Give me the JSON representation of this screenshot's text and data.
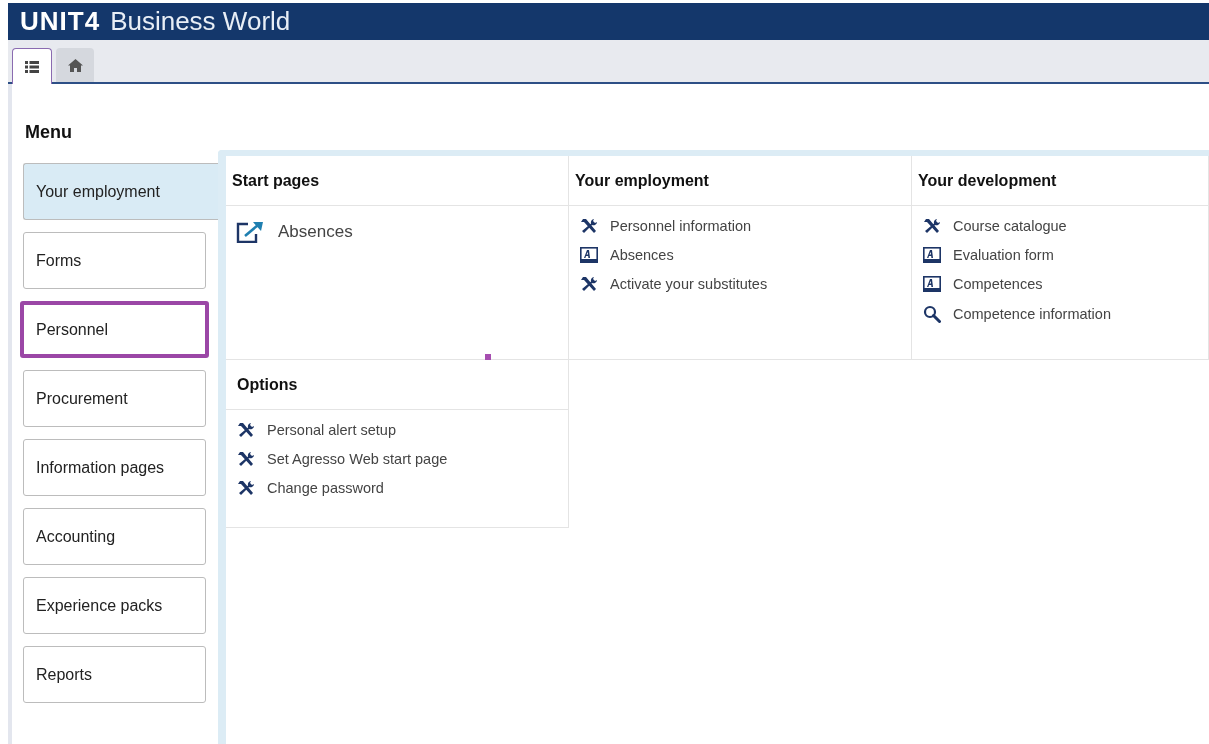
{
  "header": {
    "logo": "UNIT4",
    "product": "Business World"
  },
  "tabs": [
    {
      "kind": "list",
      "selected": true
    },
    {
      "kind": "home",
      "selected": false
    }
  ],
  "menu_title": "Menu",
  "menu_items": [
    {
      "label": "Your employment",
      "selected": true,
      "focused": false
    },
    {
      "label": "Forms",
      "selected": false,
      "focused": false
    },
    {
      "label": "Personnel",
      "selected": false,
      "focused": true
    },
    {
      "label": "Procurement",
      "selected": false,
      "focused": false
    },
    {
      "label": "Information pages",
      "selected": false,
      "focused": false
    },
    {
      "label": "Accounting",
      "selected": false,
      "focused": false
    },
    {
      "label": "Experience packs",
      "selected": false,
      "focused": false
    },
    {
      "label": "Reports",
      "selected": false,
      "focused": false
    }
  ],
  "sections": [
    {
      "title": "Start pages",
      "large": true,
      "items": [
        {
          "kind": "external",
          "label": "Absences"
        }
      ]
    },
    {
      "title": "Your employment",
      "items": [
        {
          "kind": "tools",
          "label": "Personnel information"
        },
        {
          "kind": "form",
          "label": "Absences"
        },
        {
          "kind": "tools",
          "label": "Activate your substitutes"
        }
      ]
    },
    {
      "title": "Your development",
      "items": [
        {
          "kind": "tools",
          "label": "Course catalogue"
        },
        {
          "kind": "form",
          "label": "Evaluation form"
        },
        {
          "kind": "form",
          "label": "Competences"
        },
        {
          "kind": "search",
          "label": "Competence information"
        }
      ]
    },
    {
      "title": "Options",
      "items": [
        {
          "kind": "tools",
          "label": "Personal alert setup"
        },
        {
          "kind": "tools",
          "label": "Set Agresso Web start page"
        },
        {
          "kind": "tools",
          "label": "Change password"
        }
      ]
    }
  ]
}
